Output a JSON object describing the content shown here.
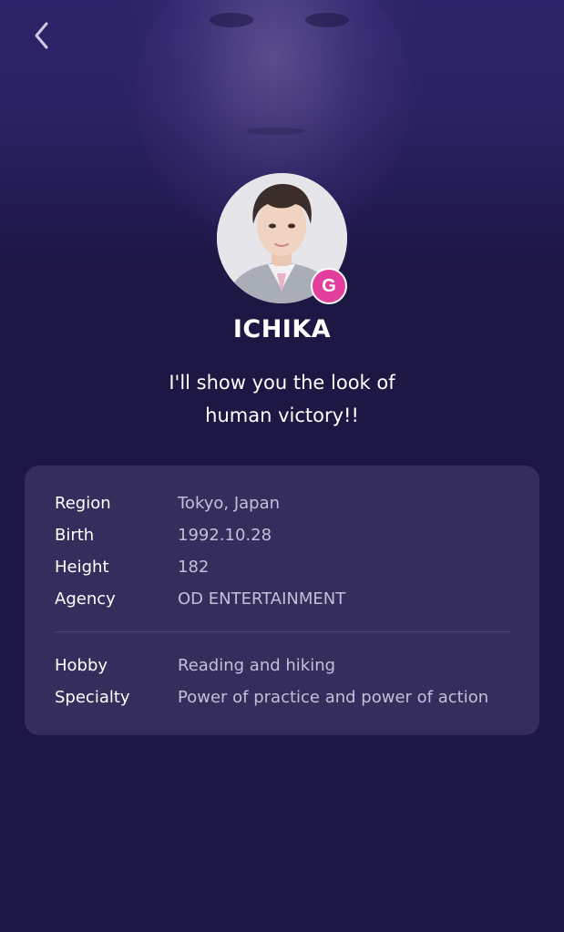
{
  "header": {
    "back_icon": "chevron-left-icon"
  },
  "profile": {
    "name": "ICHIKA",
    "grade_badge": "G",
    "motto_line1": "I'll show you the look of",
    "motto_line2": "human victory!!"
  },
  "info": {
    "basic": [
      {
        "label": "Region",
        "value": "Tokyo, Japan"
      },
      {
        "label": "Birth",
        "value": "1992.10.28"
      },
      {
        "label": "Height",
        "value": "182"
      },
      {
        "label": "Agency",
        "value": "OD ENTERTAINMENT"
      }
    ],
    "extra": [
      {
        "label": "Hobby",
        "value": "Reading and hiking"
      },
      {
        "label": "Specialty",
        "value": "Power of practice and power of action"
      }
    ]
  },
  "colors": {
    "background": "#1d1744",
    "card": "#352e5c",
    "badge": "#e23e9c",
    "value_text": "#c3bfd8"
  }
}
